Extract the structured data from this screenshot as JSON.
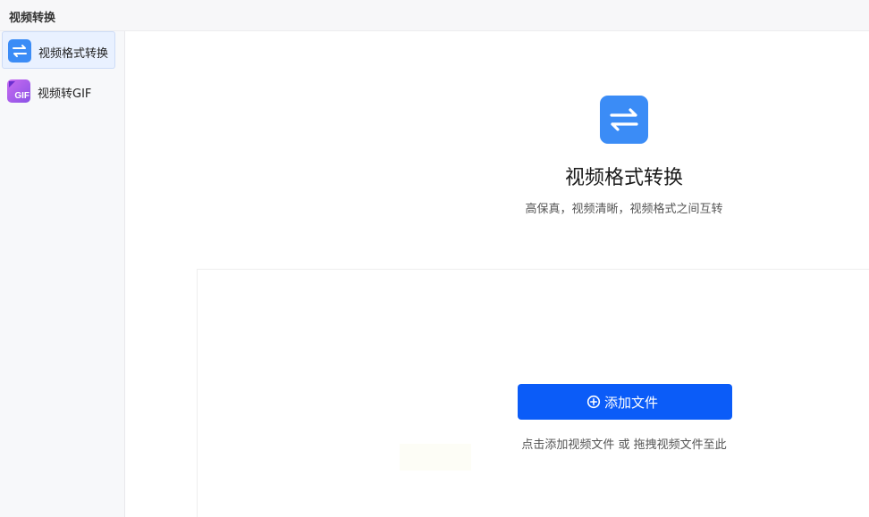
{
  "window": {
    "title": "视频转换"
  },
  "sidebar": {
    "items": [
      {
        "label": "视频格式转换",
        "icon": "swap-arrows-icon",
        "active": true
      },
      {
        "label": "视频转GIF",
        "icon": "gif-icon",
        "icon_text": "GIF",
        "active": false
      }
    ]
  },
  "main": {
    "icon": "swap-arrows-icon",
    "title": "视频格式转换",
    "subtitle": "高保真，视频清晰，视频格式之间互转",
    "add_button_label": "添加文件",
    "hint": "点击添加视频文件 或 拖拽视频文件至此"
  },
  "colors": {
    "accent": "#0b5cf8",
    "icon_blue": "#3b8cf6",
    "gif_purple": "#a35eec",
    "active_nav_bg": "#e9f1ff"
  }
}
